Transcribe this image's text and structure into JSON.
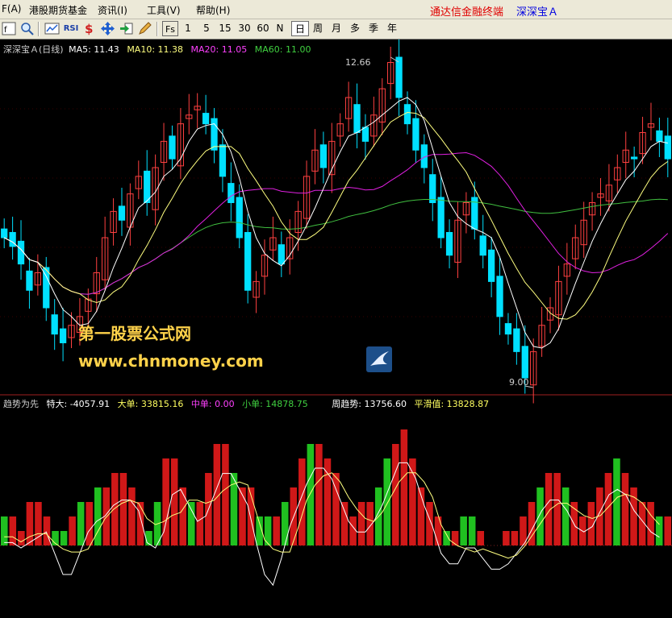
{
  "menu": {
    "items": [
      "F(A)",
      "港股期货基金",
      "资讯(I)",
      "工具(V)",
      "帮助(H)"
    ],
    "brand_red": "通达信金融终端",
    "brand_blue": "深深宝Ａ"
  },
  "toolbar": {
    "periods": [
      "1",
      "5",
      "15",
      "30",
      "60",
      "N",
      "日",
      "周",
      "月",
      "多",
      "季",
      "年"
    ],
    "selected_period": "日",
    "fs_label": "Fs",
    "rsi_label": "RSI"
  },
  "price_panel": {
    "title": "深深宝Ａ(日线)",
    "ma5": "MA5: 11.43",
    "ma10": "MA10: 11.38",
    "ma20": "MA20: 11.05",
    "ma60": "MA60: 11.00",
    "high_label": "12.66",
    "low_label": "9.00",
    "colors": {
      "up": "#ff4040",
      "down": "#00e0ff",
      "ma5": "#ffffff",
      "ma10": "#ffff80",
      "ma20": "#e020e0",
      "ma60": "#40c040"
    }
  },
  "watermark": {
    "line1": "第一股票公式网",
    "line2": "www.chnmoney.com"
  },
  "indicator_panel": {
    "name": "趋势为先",
    "te_da": "特大: -4057.91",
    "da_dan": "大单: 33815.16",
    "zhong_dan": "中单: 0.00",
    "xiao_dan": "小单: 14878.75",
    "zhou_qushi": "周趋势: 13756.60",
    "ping_hua": "平滑值: 13828.87"
  },
  "chart_data": {
    "type": "candlestick+bar",
    "price_range": [
      9.0,
      12.66
    ],
    "closes": [
      10.6,
      10.5,
      10.3,
      10.0,
      10.2,
      9.8,
      9.5,
      9.4,
      9.6,
      9.7,
      9.9,
      10.2,
      10.6,
      10.9,
      10.8,
      11.1,
      11.3,
      11.0,
      11.4,
      11.7,
      11.5,
      11.9,
      12.0,
      12.1,
      11.9,
      11.6,
      11.3,
      11.0,
      10.6,
      10.0,
      10.1,
      10.4,
      10.6,
      10.3,
      10.6,
      10.9,
      11.3,
      11.6,
      11.4,
      11.7,
      11.9,
      12.2,
      11.8,
      11.7,
      12.0,
      12.3,
      12.6,
      12.2,
      11.9,
      11.6,
      11.4,
      11.0,
      10.6,
      10.4,
      10.8,
      11.0,
      10.7,
      10.4,
      10.1,
      9.7,
      9.5,
      9.3,
      9.0,
      9.3,
      9.6,
      9.8,
      10.1,
      10.3,
      10.6,
      10.8,
      11.0,
      11.1,
      11.2,
      11.4,
      11.6,
      11.5,
      11.8,
      11.9,
      11.7,
      11.5
    ],
    "indicator_bars": [
      2,
      2,
      1,
      3,
      3,
      2,
      -1,
      -1,
      2,
      3,
      3,
      4,
      4,
      5,
      5,
      4,
      3,
      -1,
      3,
      6,
      6,
      4,
      3,
      3,
      5,
      7,
      7,
      5,
      4,
      4,
      -2,
      -2,
      2,
      3,
      4,
      6,
      7,
      7,
      6,
      5,
      3,
      2,
      3,
      3,
      4,
      6,
      7,
      8,
      6,
      4,
      3,
      2,
      -1,
      1,
      2,
      2,
      1,
      0,
      0,
      1,
      1,
      2,
      3,
      4,
      5,
      5,
      4,
      3,
      2,
      3,
      4,
      5,
      6,
      5,
      4,
      3,
      3,
      2,
      2
    ]
  }
}
